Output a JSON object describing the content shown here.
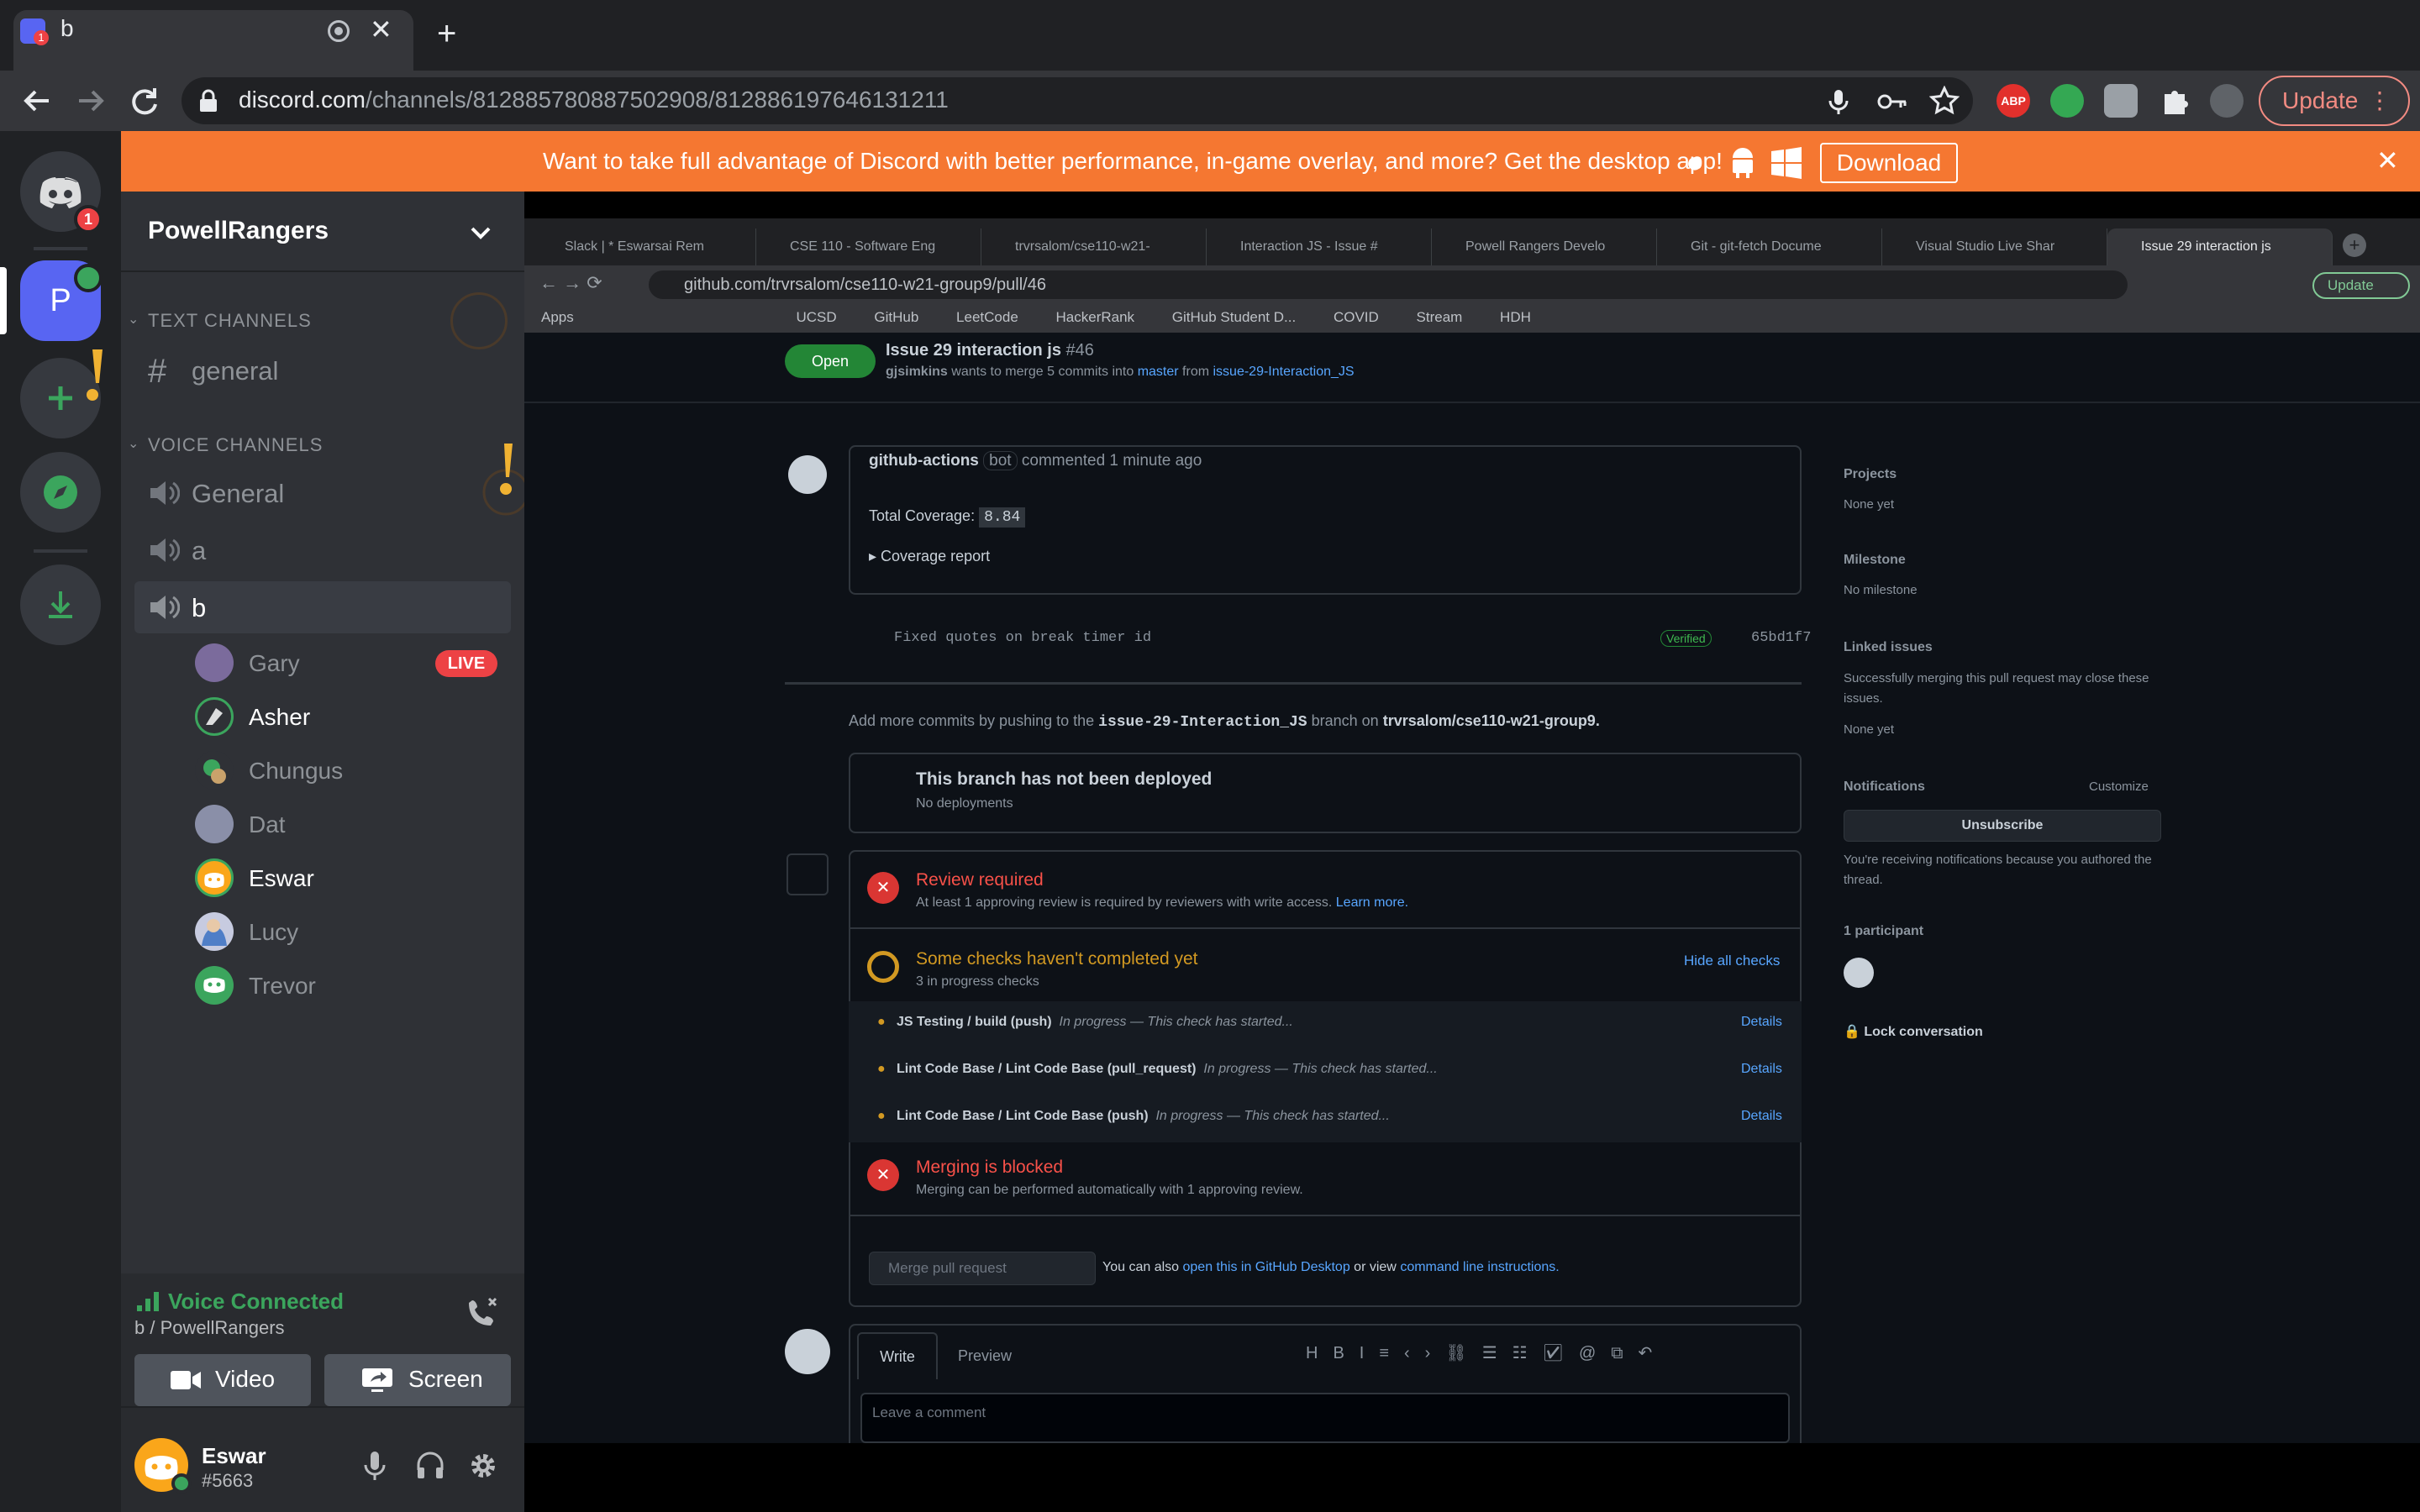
{
  "browser": {
    "tab_title": "b",
    "tab_badge": "1",
    "url_host": "discord.com",
    "url_path": "/channels/812885780887502908/812886197646131211",
    "update_label": "Update",
    "ext_abp": "ABP"
  },
  "banner": {
    "text": "Want to take full advantage of Discord with better performance, in-game overlay, and more? Get the desktop app!",
    "download_label": "Download"
  },
  "guilds": {
    "home_badge": "1",
    "server_initial": "P"
  },
  "server": {
    "name": "PowellRangers",
    "text_category": "TEXT CHANNELS",
    "text_channels": [
      "general"
    ],
    "voice_category": "VOICE CHANNELS",
    "voice_channels": [
      "General",
      "a",
      "b"
    ],
    "members": [
      {
        "name": "Gary",
        "live": "LIVE"
      },
      {
        "name": "Asher"
      },
      {
        "name": "Chungus"
      },
      {
        "name": "Dat"
      },
      {
        "name": "Eswar"
      },
      {
        "name": "Lucy"
      },
      {
        "name": "Trevor"
      }
    ]
  },
  "voice": {
    "status": "Voice Connected",
    "location": "b / PowellRangers",
    "video_label": "Video",
    "screen_label": "Screen"
  },
  "user": {
    "name": "Eswar",
    "tag": "#5663"
  },
  "stream": {
    "tabs": [
      "Slack | * Eswarsai Rem",
      "CSE 110 - Software Eng",
      "trvrsalom/cse110-w21-",
      "Interaction JS - Issue #",
      "Powell Rangers Develo",
      "Git - git-fetch Docume",
      "Visual Studio Live Shar",
      "Issue 29 interaction js"
    ],
    "url": "github.com/trvrsalom/cse110-w21-group9/pull/46",
    "bookmarks": [
      "Apps",
      "UCSD",
      "GitHub",
      "LeetCode",
      "HackerRank",
      "GitHub Student D...",
      "COVID",
      "Stream",
      "HDH"
    ],
    "pr_state": "Open",
    "pr_title": "Issue 29 interaction js",
    "pr_number": "#46",
    "pr_sub_user": "gjsimkins",
    "pr_sub_text": "wants to merge 5 commits into",
    "pr_sub_base": "master",
    "pr_sub_from": "from",
    "pr_sub_head": "issue-29-Interaction_JS",
    "bot_name": "github-actions",
    "bot_tag": "bot",
    "bot_time": "commented 1 minute ago",
    "coverage_label": "Total Coverage:",
    "coverage_value": "8.84",
    "coverage_report": "Coverage report",
    "commit_msg": "Fixed quotes on break timer id",
    "commit_verified": "Verified",
    "commit_sha": "65bd1f7",
    "push_hint_a": "Add more commits by pushing to the",
    "push_hint_branch": "issue-29-Interaction_JS",
    "push_hint_b": "branch on",
    "push_hint_repo": "trvrsalom/cse110-w21-group9.",
    "deploy_title": "This branch has not been deployed",
    "deploy_sub": "No deployments",
    "review_title": "Review required",
    "review_sub": "At least 1 approving review is required by reviewers with write access.",
    "review_link": "Learn more.",
    "checks_title": "Some checks haven't completed yet",
    "checks_sub": "3 in progress checks",
    "checks_hide": "Hide all checks",
    "checks": [
      {
        "name": "JS Testing / build (push)",
        "status": "In progress — This check has started...",
        "link": "Details"
      },
      {
        "name": "Lint Code Base / Lint Code Base (pull_request)",
        "status": "In progress — This check has started...",
        "link": "Details"
      },
      {
        "name": "Lint Code Base / Lint Code Base (push)",
        "status": "In progress — This check has started...",
        "link": "Details"
      }
    ],
    "merge_title": "Merging is blocked",
    "merge_sub": "Merging can be performed automatically with 1 approving review.",
    "merge_btn": "Merge pull request",
    "merge_hint_a": "You can also",
    "merge_hint_link1": "open this in GitHub Desktop",
    "merge_hint_b": "or view",
    "merge_hint_link2": "command line instructions.",
    "write_tab": "Write",
    "preview_tab": "Preview",
    "comment_placeholder": "Leave a comment",
    "side_projects": "Projects",
    "side_projects_val": "None yet",
    "side_milestone": "Milestone",
    "side_milestone_val": "No milestone",
    "side_linked": "Linked issues",
    "side_linked_desc": "Successfully merging this pull request may close these issues.",
    "side_linked_val": "None yet",
    "side_notifications": "Notifications",
    "side_customize": "Customize",
    "side_unsubscribe": "Unsubscribe",
    "side_notif_desc": "You're receiving notifications because you authored the thread.",
    "side_participants": "1 participant",
    "side_lock": "Lock conversation",
    "update_label": "Update"
  },
  "colors": {
    "discord_bg": "#36393f",
    "sidebar": "#2f3136",
    "banner": "#f57731",
    "voice_green": "#3ba55d",
    "live_red": "#ed4245"
  }
}
